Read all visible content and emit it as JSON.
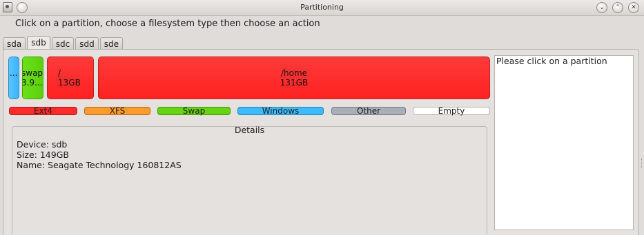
{
  "window": {
    "title": "Partitioning"
  },
  "instruction": "Click on a partition, choose a filesystem type then choose an action",
  "tabs": [
    {
      "label": "sda",
      "active": false
    },
    {
      "label": "sdb",
      "active": true
    },
    {
      "label": "sdc",
      "active": false
    },
    {
      "label": "sdd",
      "active": false
    },
    {
      "label": "sde",
      "active": false
    }
  ],
  "partitions": [
    {
      "label": "...",
      "size": "",
      "type": "Windows",
      "color": "#37b4ff"
    },
    {
      "label": "swap",
      "size": "3.9...",
      "type": "Swap",
      "color": "#5bd00b"
    },
    {
      "label": "/",
      "size": "13GB",
      "type": "Ext4",
      "color": "#ff2222"
    },
    {
      "label": "/home",
      "size": "131GB",
      "type": "Ext4",
      "color": "#ff2222"
    }
  ],
  "legend": [
    {
      "label": "Ext4",
      "color": "#ff2a2a"
    },
    {
      "label": "XFS",
      "color": "#ff9a2e"
    },
    {
      "label": "Swap",
      "color": "#66d410"
    },
    {
      "label": "Windows",
      "color": "#3dbbff"
    },
    {
      "label": "Other",
      "color": "#a8afb8"
    },
    {
      "label": "Empty",
      "color": "#ffffff"
    }
  ],
  "details": {
    "title": "Details",
    "device": "Device: sdb",
    "size": "Size: 149GB",
    "name": "Name: Seagate Technology 160812AS"
  },
  "info": {
    "text": "Please click on a partition"
  },
  "titlebar_buttons": {
    "minimize": "⌄",
    "maximize": "⌃",
    "close": "✕"
  }
}
